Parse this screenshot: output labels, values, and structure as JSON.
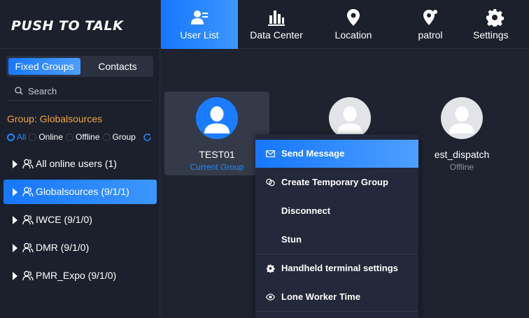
{
  "app": {
    "title": "PUSH TO TALK"
  },
  "nav": [
    {
      "label": "User List",
      "icon": "user-list-icon",
      "active": true
    },
    {
      "label": "Data Center",
      "icon": "bar-chart-icon",
      "active": false
    },
    {
      "label": "Location",
      "icon": "map-pin-icon",
      "active": false
    },
    {
      "label": "patrol",
      "icon": "patrol-pin-icon",
      "active": false
    },
    {
      "label": "Settings",
      "icon": "gear-icon",
      "active": false
    }
  ],
  "sidebar": {
    "tabs": [
      {
        "label": "Fixed Groups",
        "active": true
      },
      {
        "label": "Contacts",
        "active": false
      }
    ],
    "search": {
      "placeholder": "Search",
      "value": ""
    },
    "group_title": "Group: Globalsources",
    "filters": [
      {
        "label": "All",
        "selected": true
      },
      {
        "label": "Online",
        "selected": false
      },
      {
        "label": "Offline",
        "selected": false
      },
      {
        "label": "Group",
        "selected": false
      }
    ],
    "tree": [
      {
        "label": "All online users (1)",
        "active": false
      },
      {
        "label": "Globalsources (9/1/1)",
        "active": true
      },
      {
        "label": "IWCE (9/1/0)",
        "active": false
      },
      {
        "label": "DMR (9/1/0)",
        "active": false
      },
      {
        "label": "PMR_Expo (9/1/0)",
        "active": false
      }
    ]
  },
  "users": [
    {
      "name": "TEST01",
      "status": "Current Group",
      "avatar": "blue"
    },
    {
      "name": "",
      "status": "",
      "avatar": "grey"
    },
    {
      "name": "est_dispatch",
      "status": "Offline",
      "avatar": "grey"
    }
  ],
  "context_menu": [
    {
      "label": "Send Message",
      "icon": "envelope-icon",
      "active": true
    },
    {
      "label": "Create Temporary Group",
      "icon": "temp-group-icon",
      "active": false
    },
    {
      "label": "Disconnect",
      "icon": "",
      "active": false
    },
    {
      "label": "Stun",
      "icon": "",
      "active": false
    },
    {
      "label": "Handheld terminal settings",
      "icon": "gear-icon",
      "active": false
    },
    {
      "label": "Lone Worker Time",
      "icon": "eye-icon",
      "active": false
    }
  ],
  "colors": {
    "accent": "#1677ff",
    "group_title": "#f0a43a",
    "background": "#1f2330",
    "sidebar": "#1c202c"
  }
}
